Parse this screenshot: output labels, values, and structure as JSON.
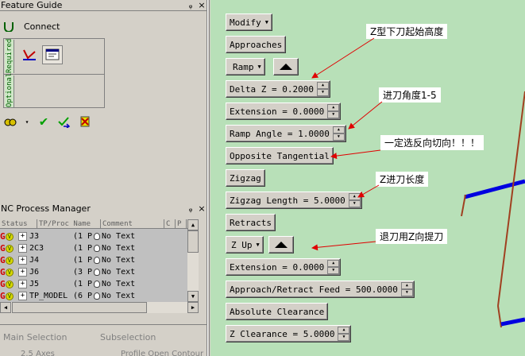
{
  "feature_guide": {
    "title": "Feature Guide",
    "connect_label": "Connect",
    "required_tab": "Required",
    "optional_tab": "Optional"
  },
  "process_manager": {
    "title": "NC Process Manager",
    "columns": [
      "Status",
      "TP/Proc Name",
      "Comment",
      "C",
      "P"
    ],
    "rows": [
      {
        "name": "J3",
        "num": "(1 P",
        "comment": "No Text"
      },
      {
        "name": "2C3",
        "num": "(1 P",
        "comment": "No Text"
      },
      {
        "name": "J4",
        "num": "(1 P",
        "comment": "No Text"
      },
      {
        "name": "J6",
        "num": "(3 P",
        "comment": "No Text"
      },
      {
        "name": "J5",
        "num": "(1 P",
        "comment": "No Text"
      },
      {
        "name": "TP_MODEL",
        "num": "(6 P",
        "comment": "No Text"
      }
    ]
  },
  "selection_bar": {
    "main_selection": "Main Selection",
    "subselection": "Subselection",
    "main_value": "2.5 Axes",
    "sub_value": "Profile Open Contour"
  },
  "params": {
    "modify": "Modify",
    "approaches": "Approaches",
    "ramp": "Ramp",
    "delta_z": "Delta Z =  0.2000",
    "extension1": "Extension =  0.0000",
    "ramp_angle": "Ramp Angle =  1.0000",
    "opposite_tangential": "Opposite Tangential",
    "zigzag": "Zigzag",
    "zigzag_length": "Zigzag Length =  5.0000",
    "retracts": "Retracts",
    "z_up": "Z Up",
    "extension2": "Extension =  0.0000",
    "feed": "Approach/Retract Feed = 500.0000",
    "absolute_clearance": "Absolute Clearance",
    "z_clearance": "Z Clearance =  5.0000"
  },
  "annotations": {
    "a1": "Z型下刀起始高度",
    "a2": "进刀角度1-5",
    "a3": "一定选反向切向！！！",
    "a4": "Z进刀长度",
    "a5": "退刀用Z向提刀"
  },
  "colors": {
    "canvas_bg": "#b8e0b8",
    "arrow": "#e00000",
    "toolpath_blue": "#0000e0",
    "toolpath_brown": "#a04020"
  }
}
